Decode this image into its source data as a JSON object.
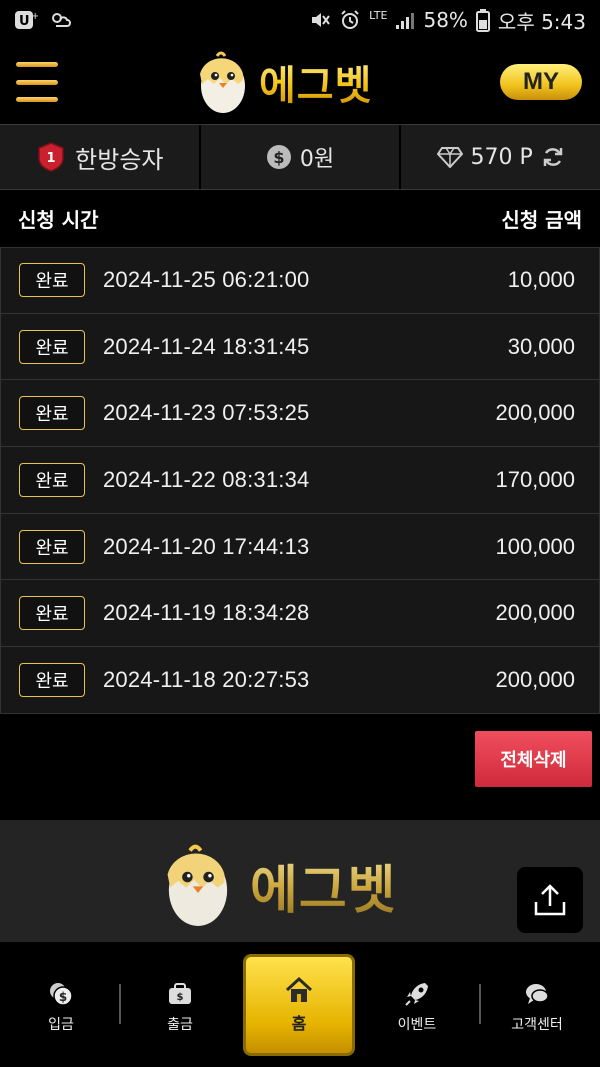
{
  "status_bar": {
    "left_icons": [
      "u-plus-icon",
      "weather-icon"
    ],
    "right_icons": [
      "mute-icon",
      "alarm-icon",
      "lte-signal-icon",
      "battery-icon"
    ],
    "network": "LTE",
    "battery": "58%",
    "time": "오후 5:43"
  },
  "header": {
    "logo_text": "에그벳",
    "my_label": "MY"
  },
  "stats": {
    "level_badge": "1",
    "nickname": "한방승자",
    "money": "0원",
    "points": "570 P"
  },
  "list": {
    "col_time": "신청 시간",
    "col_amount": "신청 금액",
    "rows": [
      {
        "status": "완료",
        "time": "2024-11-25 06:21:00",
        "amount": "10,000"
      },
      {
        "status": "완료",
        "time": "2024-11-24 18:31:45",
        "amount": "30,000"
      },
      {
        "status": "완료",
        "time": "2024-11-23 07:53:25",
        "amount": "200,000"
      },
      {
        "status": "완료",
        "time": "2024-11-22 08:31:34",
        "amount": "170,000"
      },
      {
        "status": "완료",
        "time": "2024-11-20 17:44:13",
        "amount": "100,000"
      },
      {
        "status": "완료",
        "time": "2024-11-19 18:34:28",
        "amount": "200,000"
      },
      {
        "status": "완료",
        "time": "2024-11-18 20:27:53",
        "amount": "200,000"
      }
    ],
    "delete_all_label": "전체삭제"
  },
  "footer": {
    "logo_text": "에그벳"
  },
  "bottom_nav": {
    "items": [
      {
        "label": "입금",
        "icon": "deposit-coin-icon"
      },
      {
        "label": "출금",
        "icon": "wallet-icon"
      },
      {
        "label": "홈",
        "icon": "home-icon"
      },
      {
        "label": "이벤트",
        "icon": "rocket-icon"
      },
      {
        "label": "고객센터",
        "icon": "chat-support-icon"
      }
    ]
  },
  "colors": {
    "accent_gold": "#f0c21c",
    "delete_red": "#e03c4c",
    "badge_border": "#e9c24d"
  }
}
